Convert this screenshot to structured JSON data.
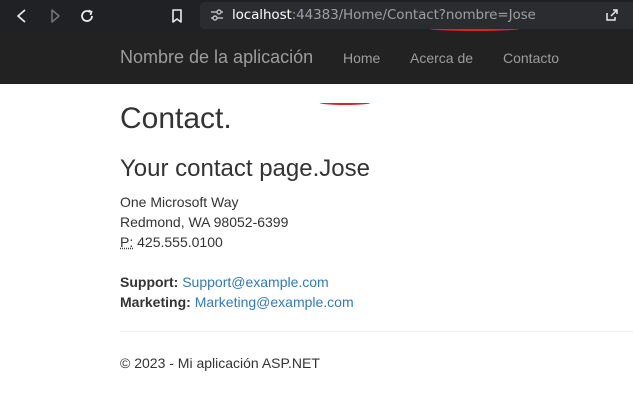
{
  "browser": {
    "url_host": "localhost",
    "url_path": ":44383/Home/Contact?",
    "url_query": "nombre=Jose"
  },
  "navbar": {
    "brand": "Nombre de la aplicación",
    "links": [
      "Home",
      "Acerca de",
      "Contacto"
    ]
  },
  "page": {
    "title": "Contact.",
    "subtitle_prefix": "Your contact page.",
    "subtitle_name": "Jose",
    "address": {
      "line1": "One Microsoft Way",
      "line2": "Redmond, WA 98052-6399",
      "phone_label": "P:",
      "phone": " 425.555.0100"
    },
    "support_label": "Support:",
    "support_email": "Support@example.com",
    "marketing_label": "Marketing:",
    "marketing_email": "Marketing@example.com"
  },
  "footer": {
    "text": "© 2023 - Mi aplicación ASP.NET"
  },
  "colors": {
    "navbar_bg": "#222222",
    "link": "#337ab7",
    "annotation": "#e0202a"
  },
  "icons": [
    "back-arrow-icon",
    "forward-arrow-icon",
    "reload-icon",
    "bookmark-icon",
    "site-info-icon",
    "share-icon"
  ]
}
